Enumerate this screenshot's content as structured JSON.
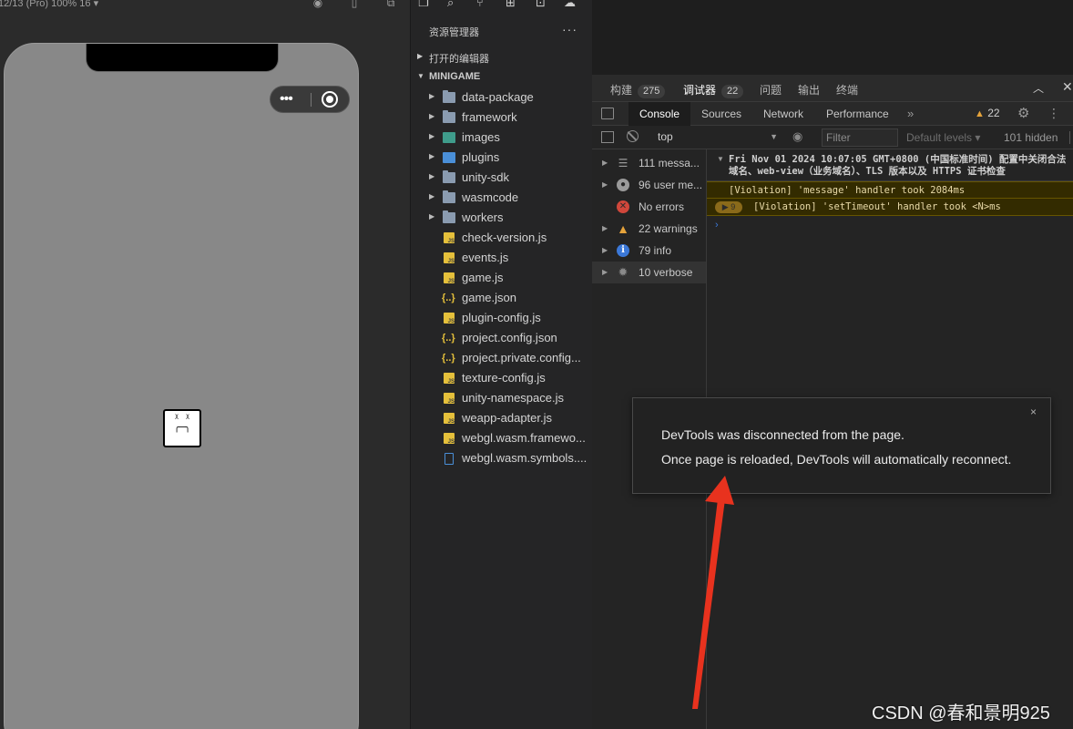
{
  "simulator": {
    "device_label": "12/13 (Pro) 100% 16 ▾",
    "capsule_more": "•••",
    "broken_face": "ᵡ ᵡ\n╭─╮"
  },
  "explorer": {
    "title": "资源管理器",
    "more": "···",
    "open_editors": "打开的编辑器",
    "project": "MINIGAME",
    "items": [
      {
        "name": "data-package",
        "type": "folder"
      },
      {
        "name": "framework",
        "type": "folder"
      },
      {
        "name": "images",
        "type": "image-folder"
      },
      {
        "name": "plugins",
        "type": "plugin-folder"
      },
      {
        "name": "unity-sdk",
        "type": "folder"
      },
      {
        "name": "wasmcode",
        "type": "folder"
      },
      {
        "name": "workers",
        "type": "folder"
      },
      {
        "name": "check-version.js",
        "type": "js"
      },
      {
        "name": "events.js",
        "type": "js"
      },
      {
        "name": "game.js",
        "type": "js"
      },
      {
        "name": "game.json",
        "type": "json"
      },
      {
        "name": "plugin-config.js",
        "type": "js"
      },
      {
        "name": "project.config.json",
        "type": "json"
      },
      {
        "name": "project.private.config...",
        "type": "json"
      },
      {
        "name": "texture-config.js",
        "type": "js"
      },
      {
        "name": "unity-namespace.js",
        "type": "js"
      },
      {
        "name": "weapp-adapter.js",
        "type": "js"
      },
      {
        "name": "webgl.wasm.framewo...",
        "type": "js"
      },
      {
        "name": "webgl.wasm.symbols....",
        "type": "file"
      }
    ]
  },
  "devtools": {
    "tabs": [
      {
        "label": "构建",
        "badge": "275"
      },
      {
        "label": "调试器",
        "badge": "22"
      },
      {
        "label": "问题",
        "badge": ""
      },
      {
        "label": "输出",
        "badge": ""
      },
      {
        "label": "终端",
        "badge": ""
      }
    ],
    "panels": [
      "Console",
      "Sources",
      "Network",
      "Performance"
    ],
    "panels_more": "»",
    "warning_count": "22",
    "context": "top",
    "filter_placeholder": "Filter",
    "levels": "Default levels ▾",
    "hidden": "101 hidden",
    "sidebar": [
      {
        "label": "111 messa...",
        "icon": "list-icon"
      },
      {
        "label": "96 user me...",
        "icon": "user-icon"
      },
      {
        "label": "No errors",
        "icon": "error-icon"
      },
      {
        "label": "22 warnings",
        "icon": "warning-icon"
      },
      {
        "label": "79 info",
        "icon": "info-icon"
      },
      {
        "label": "10 verbose",
        "icon": "verbose-icon"
      }
    ],
    "console": [
      "Fri Nov 01 2024 10:07:05 GMT+0800 (中国标准时间) 配置中关闭合法域名、web-view（业务域名）、TLS 版本以及 HTTPS 证书检查",
      "[Violation] 'message' handler took 2084ms",
      "[Violation] 'setTimeout' handler took <N>ms"
    ],
    "repeat_count": "9",
    "prompt": "›"
  },
  "dialog": {
    "close": "×",
    "line1": "DevTools was disconnected from the page.",
    "line2": "Once page is reloaded, DevTools will automatically reconnect."
  },
  "watermark": "CSDN @春和景明925",
  "colors": {
    "annotation_arrow": "#e8321e",
    "warning": "#e5a33b",
    "info": "#3b78d8",
    "error": "#d0473b"
  }
}
